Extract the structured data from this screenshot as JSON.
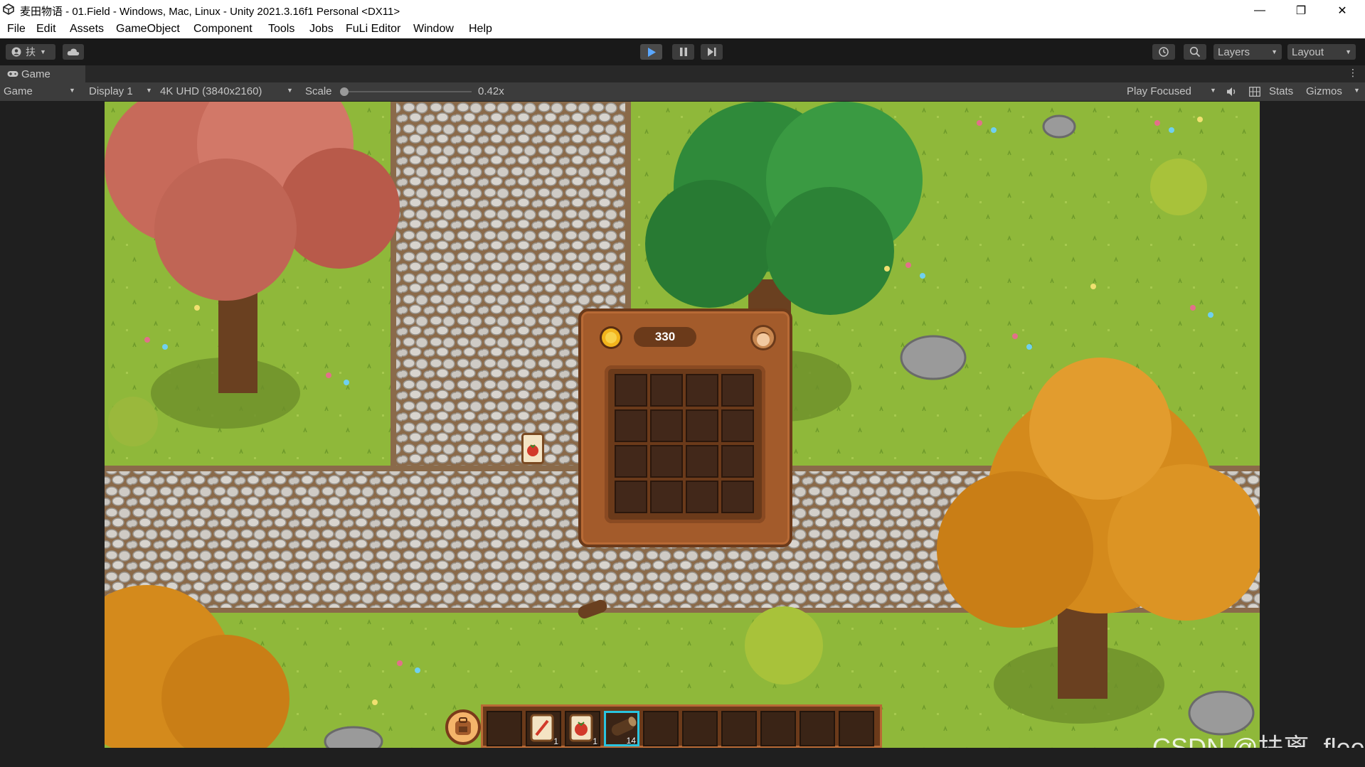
{
  "window": {
    "title": "麦田物语 - 01.Field - Windows, Mac, Linux - Unity 2021.3.16f1 Personal <DX11>",
    "minimize": "—",
    "restore": "❐",
    "close": "✕"
  },
  "menu": [
    "File",
    "Edit",
    "Assets",
    "GameObject",
    "Component",
    "Tools",
    "Jobs",
    "FuLi Editor",
    "Window",
    "Help"
  ],
  "toolbar": {
    "account_label": "扶",
    "layers_label": "Layers",
    "layout_label": "Layout"
  },
  "game_tab": {
    "tab_label": "Game"
  },
  "game_controls": {
    "view_select": "Game",
    "display_select": "Display 1",
    "resolution_select": "4K UHD (3840x2160)",
    "scale_label": "Scale",
    "scale_value": "0.42x",
    "scale_fraction": 0.0,
    "play_mode_select": "Play Focused",
    "stats_label": "Stats",
    "gizmos_label": "Gizmos"
  },
  "inventory": {
    "money": "330",
    "slot_count": 16
  },
  "hotbar": {
    "slots": [
      {
        "item": "backpack-button",
        "qty": ""
      },
      {
        "item": "",
        "qty": ""
      },
      {
        "item": "seed-bag-icon",
        "qty": "1"
      },
      {
        "item": "tomato-seed-icon",
        "qty": "1"
      },
      {
        "item": "wood-log-icon",
        "qty": "14",
        "selected": true
      },
      {
        "item": "",
        "qty": ""
      },
      {
        "item": "",
        "qty": ""
      },
      {
        "item": "",
        "qty": ""
      },
      {
        "item": "",
        "qty": ""
      },
      {
        "item": "",
        "qty": ""
      },
      {
        "item": "",
        "qty": ""
      }
    ]
  },
  "watermark": "CSDN @扶离_flee",
  "colors": {
    "editor_bg": "#191919",
    "panel_bg": "#3c3c3c",
    "grass": "#8fb83a",
    "path": "#c9c4bd",
    "inventory_frame": "#a35b2b",
    "hotbar_selected": "#29c4e0"
  }
}
